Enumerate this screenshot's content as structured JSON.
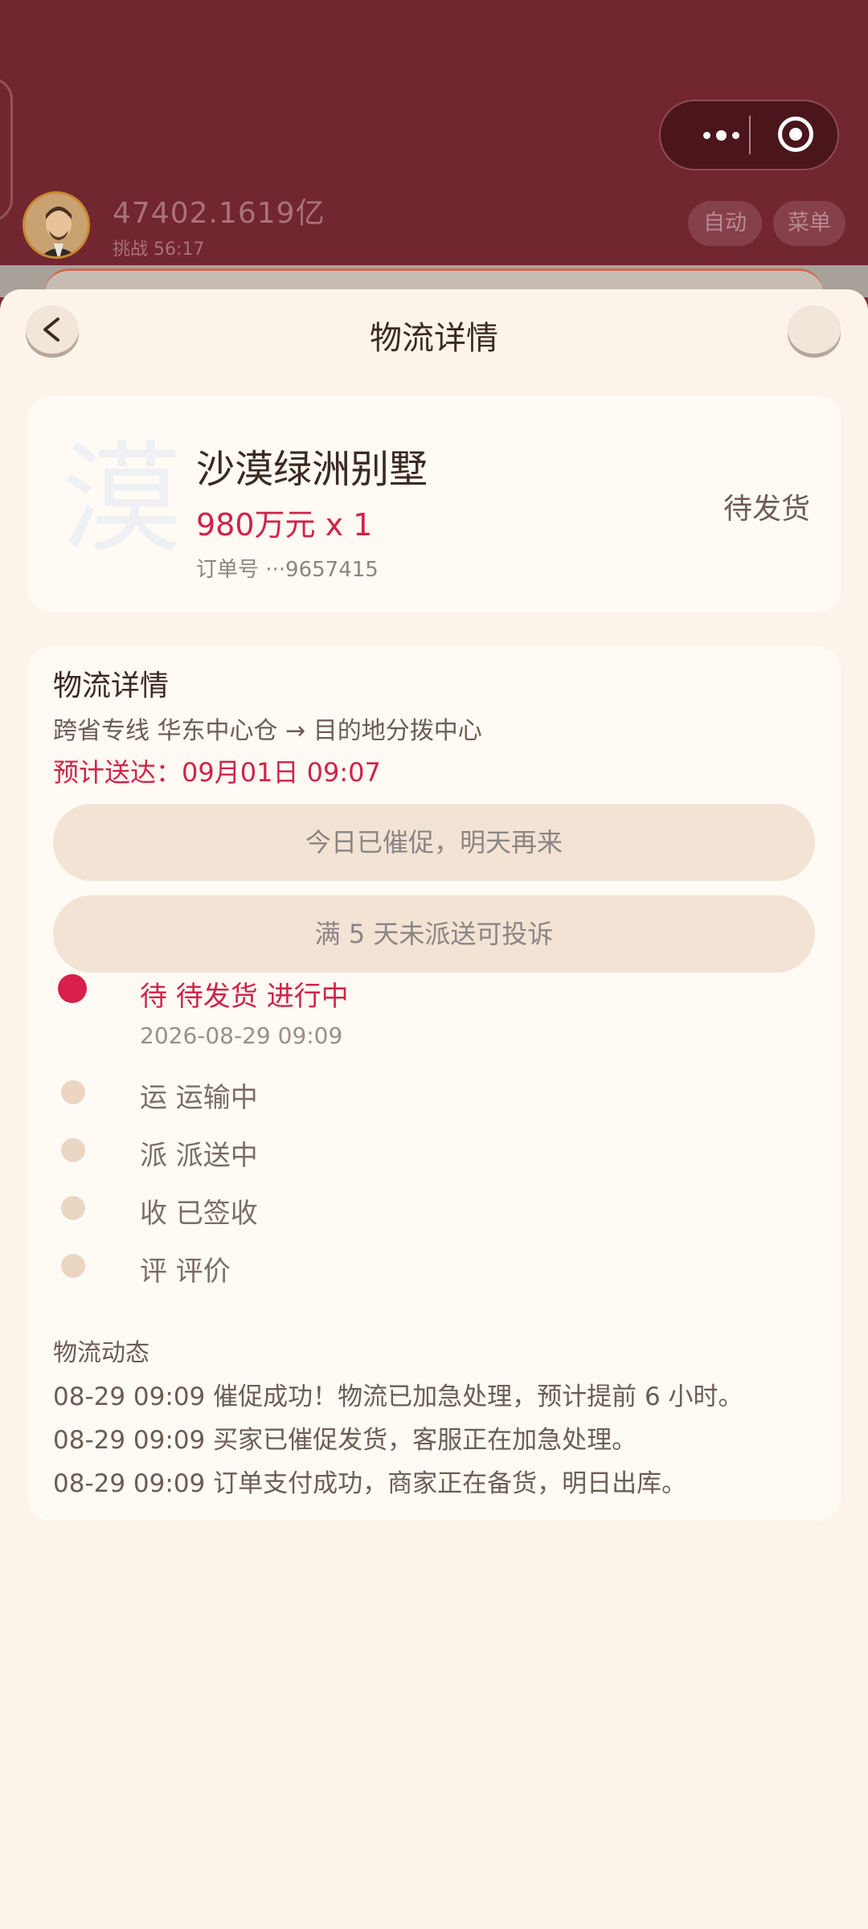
{
  "header": {
    "money": "47402.1619亿",
    "challenge": "挑战 56:17",
    "auto_label": "自动",
    "menu_label": "菜单"
  },
  "sheet": {
    "title": "物流详情",
    "back_label": "<"
  },
  "product": {
    "glyph": "漠",
    "name": "沙漠绿洲别墅",
    "price": "980万元 x 1",
    "order_no": "订单号 ···9657415",
    "status": "待发货"
  },
  "logistics": {
    "heading": "物流详情",
    "route": "跨省专线 华东中心仓 → 目的地分拨中心",
    "eta": "预计送达：09月01日 09:07",
    "urge_button": "今日已催促，明天再来",
    "complain_button": "满 5 天未派送可投诉",
    "steps": [
      {
        "label": "待 待发货 进行中",
        "time": "2026-08-29 09:09",
        "active": true
      },
      {
        "label": "运 运输中"
      },
      {
        "label": "派 派送中"
      },
      {
        "label": "收 已签收"
      },
      {
        "label": "评 评价"
      }
    ],
    "log_heading": "物流动态",
    "log": [
      "08-29 09:09 催促成功！物流已加急处理，预计提前 6 小时。",
      "08-29 09:09 买家已催促发货，客服正在加急处理。",
      "08-29 09:09 订单支付成功，商家正在备货，明日出库。"
    ]
  }
}
